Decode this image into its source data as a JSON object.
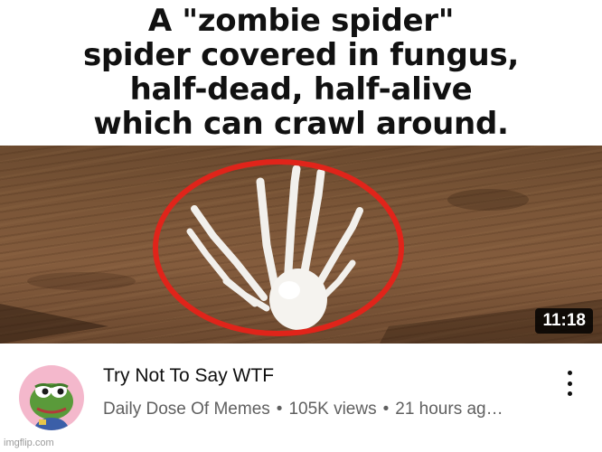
{
  "thumbnail": {
    "caption_lines": [
      "A \"zombie spider\"",
      "spider covered in fungus,",
      "half-dead, half-alive",
      "which can crawl around."
    ],
    "duration": "11:18",
    "highlight_color": "#e0241a"
  },
  "video": {
    "title": "Try Not To Say WTF",
    "channel": "Daily Dose Of Memes",
    "separator": "•",
    "views": "105K views",
    "age": "21 hours ag…"
  },
  "icons": {
    "avatar": "pepe-frog-avatar",
    "more": "more-vert-icon"
  },
  "watermark": "imgflip.com"
}
